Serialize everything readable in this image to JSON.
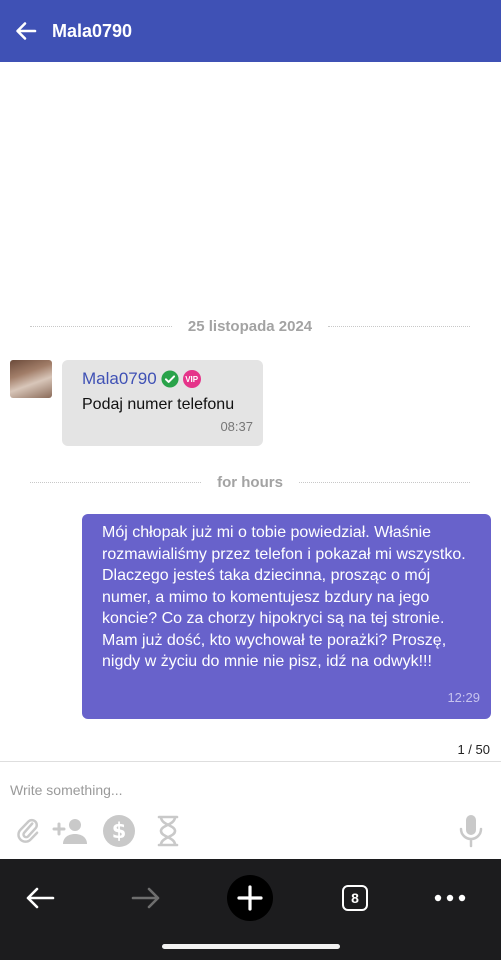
{
  "header": {
    "title": "Mala0790",
    "back_icon": "arrow-left-icon",
    "background": "#3f51b5"
  },
  "chat": {
    "date_divider": "25 listopada 2024",
    "time_divider": "for hours",
    "incoming": {
      "sender": "Mala0790",
      "verified_icon": "check-circle-icon",
      "vip_label": "VIP",
      "text": "Podaj numer telefonu",
      "time": "08:37"
    },
    "outgoing": {
      "text": "Mój chłopak już mi o tobie powiedział. Właśnie rozmawialiśmy przez telefon i pokazał mi wszystko. Dlaczego jesteś taka dziecinna, prosząc o mój numer, a mimo to komentujesz bzdury na jego koncie? Co za chorzy hipokryci są na tej stronie. Mam już dość, kto wychował te porażki? Proszę, nigdy w życiu do mnie nie pisz, idź na odwyk!!!",
      "time": "12:29",
      "color": "#6862cb"
    },
    "page_count": "1 / 50"
  },
  "composer": {
    "placeholder": "Write something...",
    "tools": [
      "paperclip-icon",
      "add-user-icon",
      "dollar-icon",
      "hourglass-icon",
      "microphone-icon"
    ]
  },
  "browser": {
    "tab_count": "8"
  }
}
